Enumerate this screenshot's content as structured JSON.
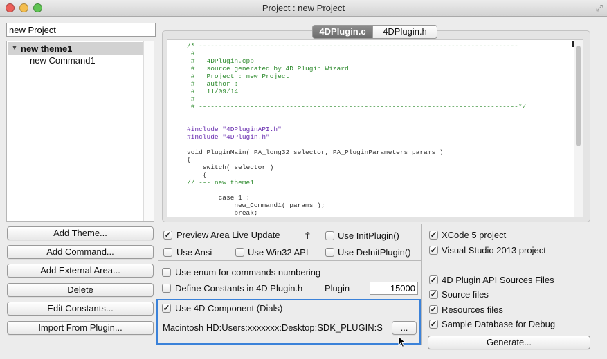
{
  "window": {
    "title": "Project : new Project"
  },
  "left": {
    "project_name": "new Project",
    "tree": {
      "theme": "new theme1",
      "command": "new Command1"
    },
    "buttons": [
      "Add Theme...",
      "Add Command...",
      "Add External Area...",
      "Delete",
      "Edit Constants...",
      "Import From Plugin..."
    ]
  },
  "tabs": {
    "active": "4DPlugin.c",
    "other": "4DPlugin.h"
  },
  "code": {
    "lines": [
      "/* ---------------------------------------------------------------------------------",
      " #",
      " #   4DPlugin.cpp",
      " #   source generated by 4D Plugin Wizard",
      " #   Project : new Project",
      " #   author :",
      " #   11/09/14",
      " #",
      " # ---------------------------------------------------------------------------------*/",
      "",
      "",
      "#include \"4DPluginAPI.h\"",
      "#include \"4DPlugin.h\"",
      "",
      "void PluginMain( PA_long32 selector, PA_PluginParameters params )",
      "{",
      "    switch( selector )",
      "    {",
      "// --- new theme1",
      "",
      "        case 1 :",
      "            new_Command1( params );",
      "            break;"
    ]
  },
  "options": {
    "preview_live": {
      "label": "Preview Area Live Update",
      "checked": true
    },
    "clipped_glyph": "T́",
    "use_ansi": {
      "label": "Use Ansi",
      "checked": false
    },
    "use_win32": {
      "label": "Use Win32 API",
      "checked": false
    },
    "use_initplugin": {
      "label": "Use InitPlugin()",
      "checked": false
    },
    "use_deinitplugin": {
      "label": "Use DeInitPlugin()",
      "checked": false
    },
    "use_enum": {
      "label": "Use enum for commands numbering",
      "checked": false
    },
    "define_constants": {
      "label": "Define Constants in 4D Plugin.h",
      "checked": false
    },
    "plugin_label": "Plugin",
    "plugin_number": "15000",
    "use_4d_component": {
      "label": "Use 4D Component (Dials)",
      "checked": true
    },
    "component_path": "Macintosh HD:Users:xxxxxxx:Desktop:SDK_PLUGIN:S",
    "browse_label": "...",
    "xcode5": {
      "label": "XCode 5 project",
      "checked": true
    },
    "vs2013": {
      "label": "Visual Studio 2013 project",
      "checked": true
    },
    "api_sources": {
      "label": "4D Plugin API Sources Files",
      "checked": true
    },
    "source_files": {
      "label": "Source files",
      "checked": true
    },
    "resources_files": {
      "label": "Resources files",
      "checked": true
    },
    "sample_db": {
      "label": "Sample Database for Debug",
      "checked": true
    },
    "generate_label": "Generate..."
  },
  "colors": {
    "focus_ring": "#3b82d9",
    "tab_active": "#7a7a7a",
    "comment": "#2e8b2e",
    "keyword": "#3a3ac9",
    "include": "#6a2fb0"
  }
}
